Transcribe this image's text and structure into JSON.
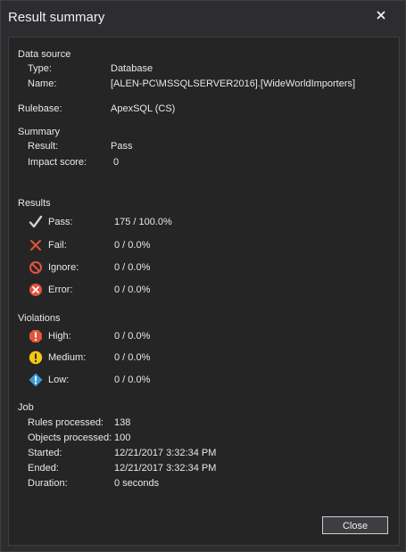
{
  "window": {
    "title": "Result summary"
  },
  "data_source": {
    "heading": "Data source",
    "type_label": "Type:",
    "type_value": "Database",
    "name_label": "Name:",
    "name_value": "[ALEN-PC\\MSSQLSERVER2016].[WideWorldImporters]"
  },
  "rulebase": {
    "label": "Rulebase:",
    "value": "ApexSQL (CS)"
  },
  "summary": {
    "heading": "Summary",
    "result_label": "Result:",
    "result_value": "Pass",
    "impact_label": "Impact score:",
    "impact_value": "0"
  },
  "results": {
    "heading": "Results",
    "pass_label": "Pass:",
    "pass_value": "175 / 100.0%",
    "fail_label": "Fail:",
    "fail_value": "0 / 0.0%",
    "ignore_label": "Ignore:",
    "ignore_value": "0 / 0.0%",
    "error_label": "Error:",
    "error_value": "0 / 0.0%"
  },
  "violations": {
    "heading": "Violations",
    "high_label": "High:",
    "high_value": "0 / 0.0%",
    "medium_label": "Medium:",
    "medium_value": "0 / 0.0%",
    "low_label": "Low:",
    "low_value": "0 / 0.0%"
  },
  "job": {
    "heading": "Job",
    "rules_label": "Rules processed:",
    "rules_value": "138",
    "objects_label": "Objects processed:",
    "objects_value": "100",
    "started_label": "Started:",
    "started_value": "12/21/2017 3:32:34 PM",
    "ended_label": "Ended:",
    "ended_value": "12/21/2017 3:32:34 PM",
    "duration_label": "Duration:",
    "duration_value": "0 seconds"
  },
  "buttons": {
    "close_label": "Close"
  },
  "colors": {
    "background": "#2d2d30",
    "panel": "#252526",
    "fail": "#e0553b",
    "error": "#e0553b",
    "high": "#e0553b",
    "medium": "#f2c811",
    "low": "#3e9ad6",
    "pass": "#d0d0d0"
  }
}
